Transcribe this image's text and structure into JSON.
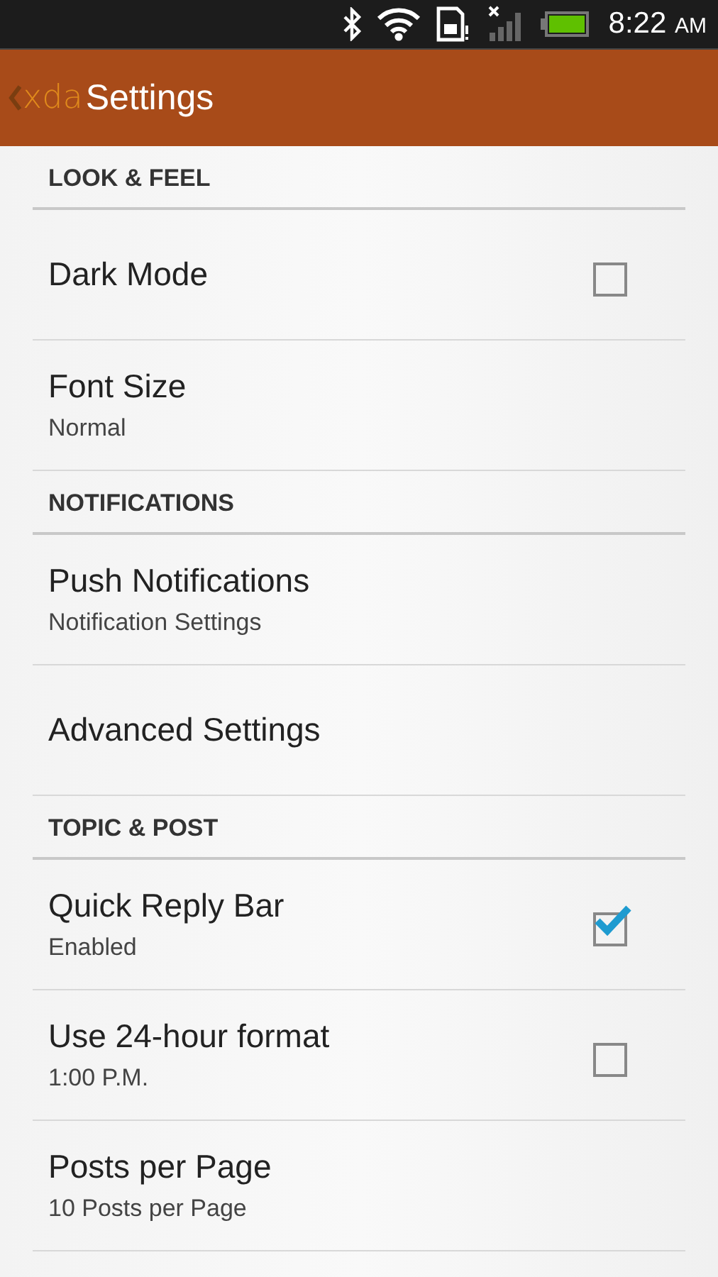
{
  "status_bar": {
    "time": "8:22",
    "meridiem": "AM"
  },
  "app_bar": {
    "logo": "xda",
    "title": "Settings"
  },
  "sections": [
    {
      "title": "LOOK & FEEL",
      "items": [
        {
          "kind": "checkbox",
          "title": "Dark Mode",
          "checked": false
        },
        {
          "kind": "option",
          "title": "Font Size",
          "summary": "Normal"
        }
      ]
    },
    {
      "title": "NOTIFICATIONS",
      "items": [
        {
          "kind": "option",
          "title": "Push Notifications",
          "summary": "Notification Settings"
        },
        {
          "kind": "option",
          "title": "Advanced Settings"
        }
      ]
    },
    {
      "title": "TOPIC & POST",
      "items": [
        {
          "kind": "checkbox",
          "title": "Quick Reply Bar",
          "summary": "Enabled",
          "checked": true
        },
        {
          "kind": "checkbox",
          "title": "Use 24-hour format",
          "summary": "1:00 P.M.",
          "checked": false
        },
        {
          "kind": "option",
          "title": "Posts per Page",
          "summary": "10 Posts per Page"
        }
      ]
    }
  ]
}
